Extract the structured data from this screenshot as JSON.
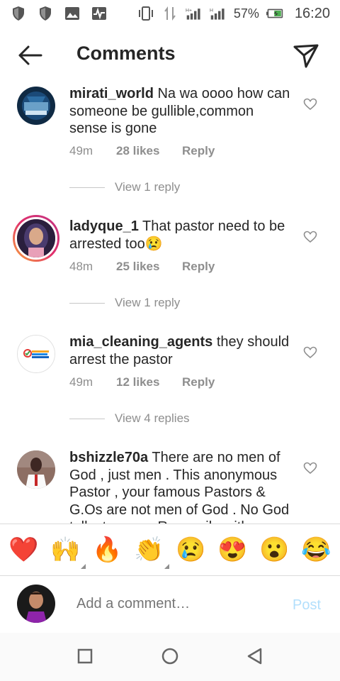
{
  "status_bar": {
    "battery": "57%",
    "time": "16:20",
    "left_icons": [
      "shield-icon",
      "shield-icon",
      "image-icon",
      "activity-icon"
    ],
    "right_icons": [
      "vibrate-icon",
      "data-icon",
      "signal-icon",
      "signal-icon",
      "battery-icon"
    ]
  },
  "header": {
    "title": "Comments",
    "back_icon": "arrow-left-icon",
    "send_icon": "paper-plane-icon"
  },
  "comments": [
    {
      "username": "mirati_world",
      "text": " Na wa oooo how can someone be gullible,common sense is gone",
      "time": "49m",
      "likes": "28 likes",
      "reply": "Reply",
      "view_replies": "View 1 reply"
    },
    {
      "username": "ladyque_1",
      "text": " That pastor need to be arrested too😢",
      "time": "48m",
      "likes": "25 likes",
      "reply": "Reply",
      "view_replies": "View 1 reply"
    },
    {
      "username": "mia_cleaning_agents",
      "text": " they should arrest the pastor",
      "time": "49m",
      "likes": "12 likes",
      "reply": "Reply",
      "view_replies": "View 4 replies"
    },
    {
      "username": "bshizzle70a",
      "text": " There are no men of God , just men . This anonymous Pastor , your famous Pastors & G.Os are not men of God . No God talks to men . Reconcile with"
    }
  ],
  "emoji_bar": [
    "❤️",
    "🙌",
    "🔥",
    "👏",
    "😢",
    "😍",
    "😮",
    "😂"
  ],
  "add_comment": {
    "placeholder": "Add a comment…",
    "post_label": "Post"
  },
  "colors": {
    "text": "#262626",
    "secondary": "#8e8e8e",
    "post_disabled": "#b2dffc"
  }
}
